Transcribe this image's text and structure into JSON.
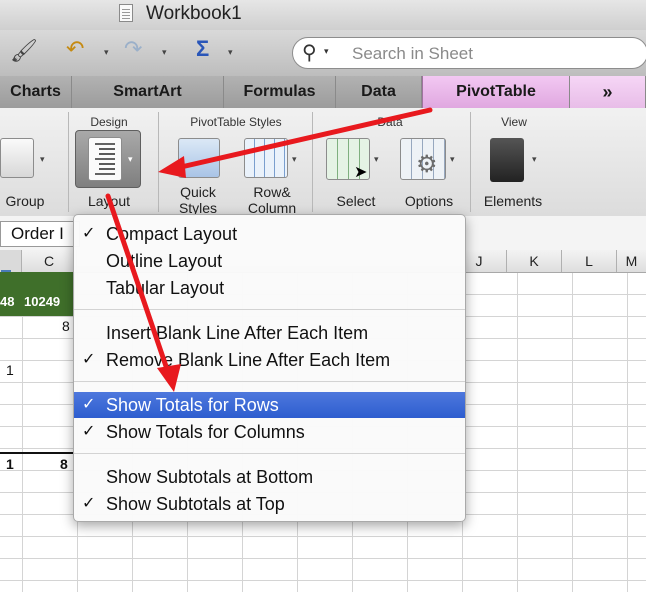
{
  "window": {
    "title": "Workbook1"
  },
  "search": {
    "placeholder": "Search in Sheet"
  },
  "ribbon_tabs": [
    {
      "label": "Charts"
    },
    {
      "label": "SmartArt"
    },
    {
      "label": "Formulas"
    },
    {
      "label": "Data"
    },
    {
      "label": "PivotTable"
    },
    {
      "label": "»"
    }
  ],
  "ribbon_groups": {
    "design": "Design",
    "pivottable_styles": "PivotTable Styles",
    "data": "Data",
    "view": "View"
  },
  "ribbon_buttons": {
    "group": "Group",
    "layout": "Layout",
    "quick_styles_1": "Quick",
    "quick_styles_2": "Styles",
    "row_column_1": "Row&",
    "row_column_2": "Column",
    "select": "Select",
    "options": "Options",
    "elements": "Elements"
  },
  "name_box": "Order I",
  "columns": [
    "C",
    "J",
    "K",
    "L",
    "M"
  ],
  "cells": {
    "row1_a": "48",
    "row1_b": "10249",
    "row2_b": "8",
    "row3_a": "1",
    "row4_a": "1",
    "row4_b": "8"
  },
  "layout_menu": {
    "items": [
      {
        "label": "Compact Layout",
        "checked": true
      },
      {
        "label": "Outline Layout",
        "checked": false
      },
      {
        "label": "Tabular Layout",
        "checked": false
      },
      {
        "label": "Insert Blank Line After Each Item",
        "checked": false
      },
      {
        "label": "Remove Blank Line After Each Item",
        "checked": true
      },
      {
        "label": "Show Totals for Rows",
        "checked": true,
        "highlighted": true
      },
      {
        "label": "Show Totals for Columns",
        "checked": true
      },
      {
        "label": "Show Subtotals at Bottom",
        "checked": false
      },
      {
        "label": "Show Subtotals at Top",
        "checked": true
      }
    ],
    "check_glyph": "✓"
  },
  "colors": {
    "pivottable_tab": "#e0a8e0",
    "menu_highlight": "#2d5dcf",
    "annotation_arrow": "#e8191e"
  }
}
